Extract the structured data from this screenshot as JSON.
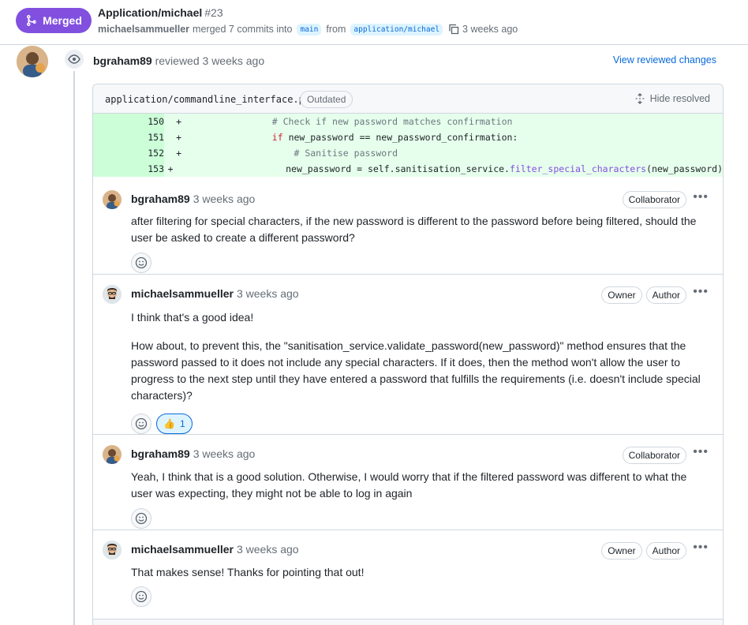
{
  "header": {
    "status": "Merged",
    "title": "Application/michael",
    "number": "#23",
    "author": "michaelsammueller",
    "merge_text": "merged 7 commits into",
    "base_branch": "main",
    "from_text": "from",
    "head_branch": "application/michael",
    "time": "3 weeks ago",
    "accent": "#8250df"
  },
  "review": {
    "reviewer": "bgraham89",
    "action": "reviewed",
    "time": "3 weeks ago",
    "view_changes_label": "View reviewed changes",
    "file": "application/commandline_interface.py",
    "file_status": "Outdated",
    "hide_resolved_label": "Hide resolved",
    "diff_lines": [
      {
        "num": "150",
        "sign": "+",
        "indent": "                ",
        "code": "# Check if new password matches confirmation"
      },
      {
        "num": "151",
        "sign": "+",
        "indent": "                ",
        "kw": "if",
        "code": " new_password == new_password_confirmation:"
      },
      {
        "num": "152",
        "sign": "+",
        "indent": "                    ",
        "code": "# Sanitise password"
      },
      {
        "num": "153",
        "sign": "+",
        "indent": "                    ",
        "pre": "new_password = self.sanitisation_service.",
        "fn": "filter_special_characters",
        "post": "(new_password)"
      }
    ]
  },
  "comments": [
    {
      "author": "bgraham89",
      "time": "3 weeks ago",
      "badges": [
        "Collaborator"
      ],
      "paragraphs": [
        "after filtering for special characters, if the new password is different to the password before being filtered, should the user be asked to create a different password?"
      ]
    },
    {
      "author": "michaelsammueller",
      "time": "3 weeks ago",
      "badges": [
        "Owner",
        "Author"
      ],
      "paragraphs": [
        "I think that's a good idea!",
        "How about, to prevent this, the \"sanitisation_service.validate_password(new_password)\" method ensures that the password passed to it does not include any special characters. If it does, then the method won't allow the user to progress to the next step until they have entered a password that fulfills the requirements (i.e. doesn't include special characters)?"
      ],
      "reaction": {
        "emoji": "👍",
        "count": "1"
      }
    },
    {
      "author": "bgraham89",
      "time": "3 weeks ago",
      "badges": [
        "Collaborator"
      ],
      "paragraphs": [
        "Yeah, I think that is a good solution. Otherwise, I would worry that if the filtered password was different to what the user was expecting, they might not be able to log in again"
      ]
    },
    {
      "author": "michaelsammueller",
      "time": "3 weeks ago",
      "badges": [
        "Owner",
        "Author"
      ],
      "paragraphs": [
        "That makes sense! Thanks for pointing that out!"
      ]
    }
  ],
  "icons": {
    "merge": "git-merge-icon",
    "copy": "copy-icon",
    "eye": "eye-icon",
    "unfold": "unfold-icon",
    "smiley": "smiley-icon",
    "kebab": "kebab-horizontal-icon"
  }
}
